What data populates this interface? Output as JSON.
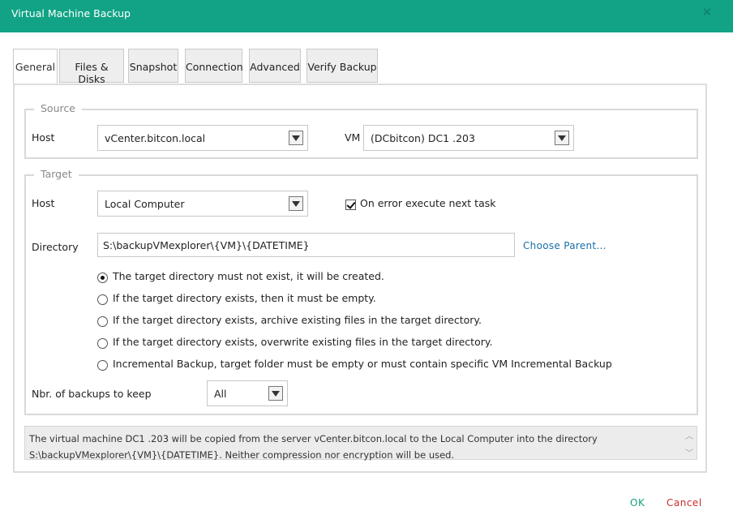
{
  "window": {
    "title": "Virtual Machine Backup"
  },
  "tabs": [
    {
      "label": "General"
    },
    {
      "label": "Files & Disks"
    },
    {
      "label": "Snapshot"
    },
    {
      "label": "Connection"
    },
    {
      "label": "Advanced"
    },
    {
      "label": "Verify Backup"
    }
  ],
  "source": {
    "legend": "Source",
    "host_label": "Host",
    "host_value": "vCenter.bitcon.local",
    "vm_label": "VM",
    "vm_value": "(DCbitcon) DC1 .203"
  },
  "target": {
    "legend": "Target",
    "host_label": "Host",
    "host_value": "Local Computer",
    "on_error_label": "On error execute next task",
    "on_error_checked": true,
    "directory_label": "Directory",
    "directory_value": "S:\\backupVMexplorer\\{VM}\\{DATETIME}",
    "choose_parent": "Choose Parent...",
    "options": [
      {
        "label": "The target directory must not exist, it will be created.",
        "checked": true
      },
      {
        "label": "If the target directory exists, then it must be empty.",
        "checked": false
      },
      {
        "label": "If the target directory exists, archive existing files in the target directory.",
        "checked": false
      },
      {
        "label": "If the target directory exists, overwrite existing files in the target directory.",
        "checked": false
      },
      {
        "label": "Incremental Backup, target folder must be empty or must contain specific VM Incremental Backup",
        "checked": false
      }
    ],
    "backups_label": "Nbr. of backups to keep",
    "backups_value": "All"
  },
  "summary": "The virtual machine DC1 .203 will be copied from the server vCenter.bitcon.local to the Local Computer into the directory S:\\backupVMexplorer\\{VM}\\{DATETIME}. Neither compression nor encryption will be used.",
  "buttons": {
    "ok": "OK",
    "cancel": "Cancel"
  },
  "colors": {
    "titlebar": "#12a386",
    "link": "#1a6fa8",
    "ok": "#15a07f",
    "cancel": "#cc2c2c"
  }
}
